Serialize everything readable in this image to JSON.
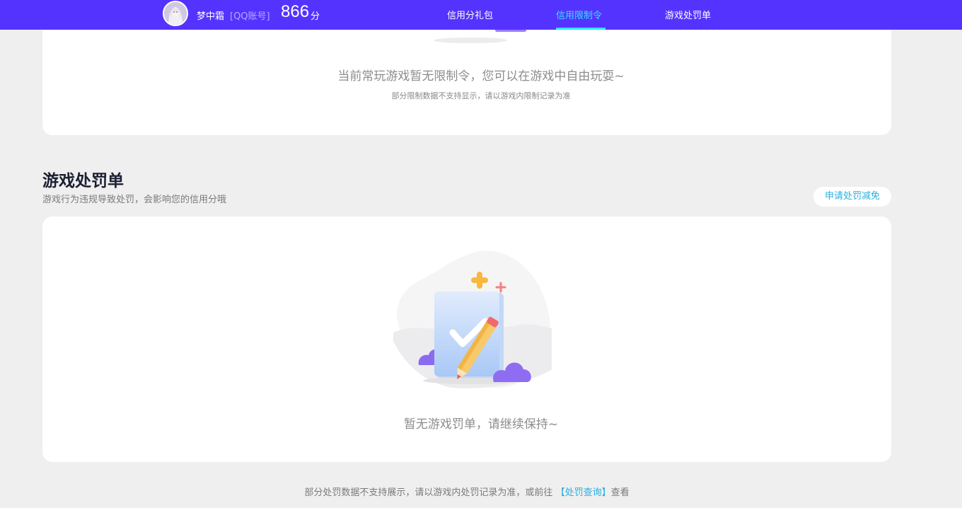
{
  "header": {
    "username": "梦中霜",
    "account_type": "[QQ账号]",
    "score": "866",
    "score_unit": "分",
    "tabs": [
      {
        "label": "信用分礼包",
        "active": false
      },
      {
        "label": "信用限制令",
        "active": true
      },
      {
        "label": "游戏处罚单",
        "active": false
      }
    ],
    "colors": {
      "bar": "#5533ff",
      "active_tab": "#33e3ff"
    }
  },
  "restriction_section": {
    "empty_title": "当前常玩游戏暂无限制令，您可以在游戏中自由玩耍~",
    "empty_note": "部分限制数据不支持显示，请以游戏内限制记录为准"
  },
  "penalty_section": {
    "title": "游戏处罚单",
    "description": "游戏行为违规导致处罚，会影响您的信用分哦",
    "appeal_button": "申请处罚减免",
    "empty_title": "暂无游戏罚单，请继续保持~",
    "illustration_icon": "document-check-pencil-icon"
  },
  "footer": {
    "note_prefix": "部分处罚数据不支持展示，请以游戏内处罚记录为准，或前往",
    "link_label": "【处罚查询】",
    "note_suffix": "查看"
  }
}
